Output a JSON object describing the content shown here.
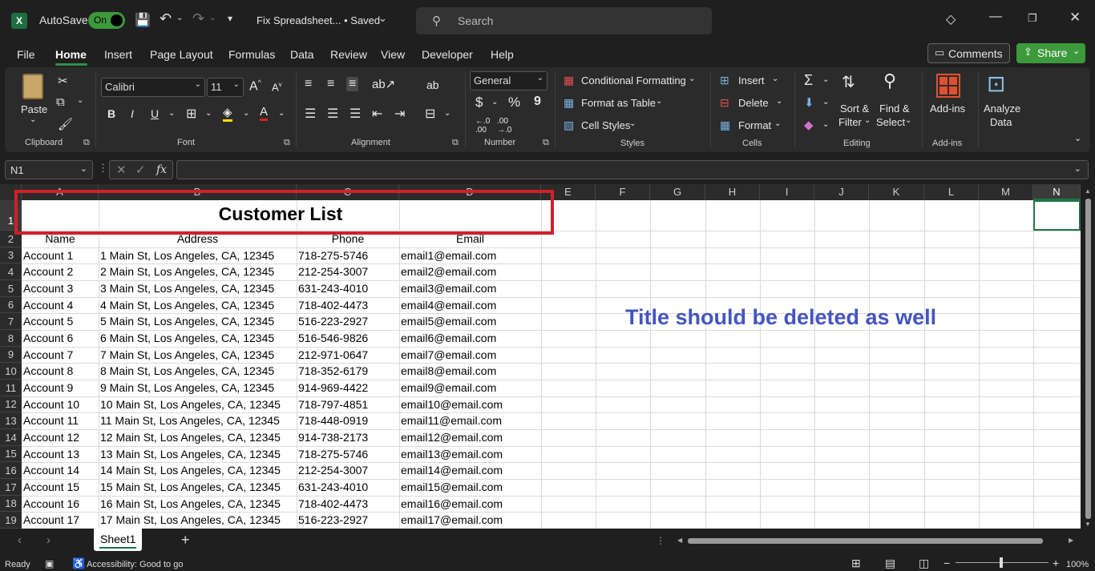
{
  "titlebar": {
    "autosave_label": "AutoSave",
    "toggle_label": "On",
    "filename": "Fix Spreadsheet... • Saved",
    "search_placeholder": "Search"
  },
  "menu": [
    "File",
    "Home",
    "Insert",
    "Page Layout",
    "Formulas",
    "Data",
    "Review",
    "View",
    "Developer",
    "Help"
  ],
  "menu_active": "Home",
  "buttons": {
    "comments": "Comments",
    "share": "Share"
  },
  "ribbon": {
    "clipboard": {
      "paste": "Paste",
      "group": "Clipboard"
    },
    "font": {
      "name": "Calibri",
      "size": "11",
      "group": "Font",
      "bold": "B",
      "italic": "I",
      "underline": "U"
    },
    "alignment": {
      "group": "Alignment"
    },
    "number": {
      "format": "General",
      "group": "Number",
      "currency": "$",
      "percent": "%",
      "comma": "9"
    },
    "styles": {
      "conditional": "Conditional Formatting",
      "table": "Format as Table",
      "cell": "Cell Styles",
      "group": "Styles"
    },
    "cells": {
      "insert": "Insert",
      "delete": "Delete",
      "format": "Format",
      "group": "Cells"
    },
    "editing": {
      "sort1": "Sort &",
      "sort2": "Filter",
      "find1": "Find &",
      "find2": "Select",
      "group": "Editing"
    },
    "addins": {
      "label": "Add-ins",
      "group": "Add-ins"
    },
    "analyze": {
      "l1": "Analyze",
      "l2": "Data"
    }
  },
  "formula_bar": {
    "name_box": "N1",
    "fx": "fx",
    "value": ""
  },
  "columns": [
    "A",
    "B",
    "C",
    "D",
    "E",
    "F",
    "G",
    "H",
    "I",
    "J",
    "K",
    "L",
    "M",
    "N"
  ],
  "title_cell": "Customer List",
  "headers": [
    "Name",
    "Address",
    "Phone",
    "Email"
  ],
  "rows": [
    [
      "Account 1",
      "1 Main St, Los Angeles, CA, 12345",
      "718-275-5746",
      "email1@email.com"
    ],
    [
      "Account 2",
      "2 Main St, Los Angeles, CA, 12345",
      "212-254-3007",
      "email2@email.com"
    ],
    [
      "Account 3",
      "3 Main St, Los Angeles, CA, 12345",
      "631-243-4010",
      "email3@email.com"
    ],
    [
      "Account 4",
      "4 Main St, Los Angeles, CA, 12345",
      "718-402-4473",
      "email4@email.com"
    ],
    [
      "Account 5",
      "5 Main St, Los Angeles, CA, 12345",
      "516-223-2927",
      "email5@email.com"
    ],
    [
      "Account 6",
      "6 Main St, Los Angeles, CA, 12345",
      "516-546-9826",
      "email6@email.com"
    ],
    [
      "Account 7",
      "7 Main St, Los Angeles, CA, 12345",
      "212-971-0647",
      "email7@email.com"
    ],
    [
      "Account 8",
      "8 Main St, Los Angeles, CA, 12345",
      "718-352-6179",
      "email8@email.com"
    ],
    [
      "Account 9",
      "9 Main St, Los Angeles, CA, 12345",
      "914-969-4422",
      "email9@email.com"
    ],
    [
      "Account 10",
      "10 Main St, Los Angeles, CA, 12345",
      "718-797-4851",
      "email10@email.com"
    ],
    [
      "Account 11",
      "11 Main St, Los Angeles, CA, 12345",
      "718-448-0919",
      "email11@email.com"
    ],
    [
      "Account 12",
      "12 Main St, Los Angeles, CA, 12345",
      "914-738-2173",
      "email12@email.com"
    ],
    [
      "Account 13",
      "13 Main St, Los Angeles, CA, 12345",
      "718-275-5746",
      "email13@email.com"
    ],
    [
      "Account 14",
      "14 Main St, Los Angeles, CA, 12345",
      "212-254-3007",
      "email14@email.com"
    ],
    [
      "Account 15",
      "15 Main St, Los Angeles, CA, 12345",
      "631-243-4010",
      "email15@email.com"
    ],
    [
      "Account 16",
      "16 Main St, Los Angeles, CA, 12345",
      "718-402-4473",
      "email16@email.com"
    ],
    [
      "Account 17",
      "17 Main St, Los Angeles, CA, 12345",
      "516-223-2927",
      "email17@email.com"
    ]
  ],
  "annotation": "Title should be deleted as well",
  "colors": {
    "annotation": "#4455c0",
    "highlight_box": "#d0202a",
    "share": "#3c9a3c",
    "selection": "#217346"
  },
  "sheet_tab": "Sheet1",
  "status": {
    "ready": "Ready",
    "accessibility": "Accessibility: Good to go",
    "zoom": "100%"
  }
}
